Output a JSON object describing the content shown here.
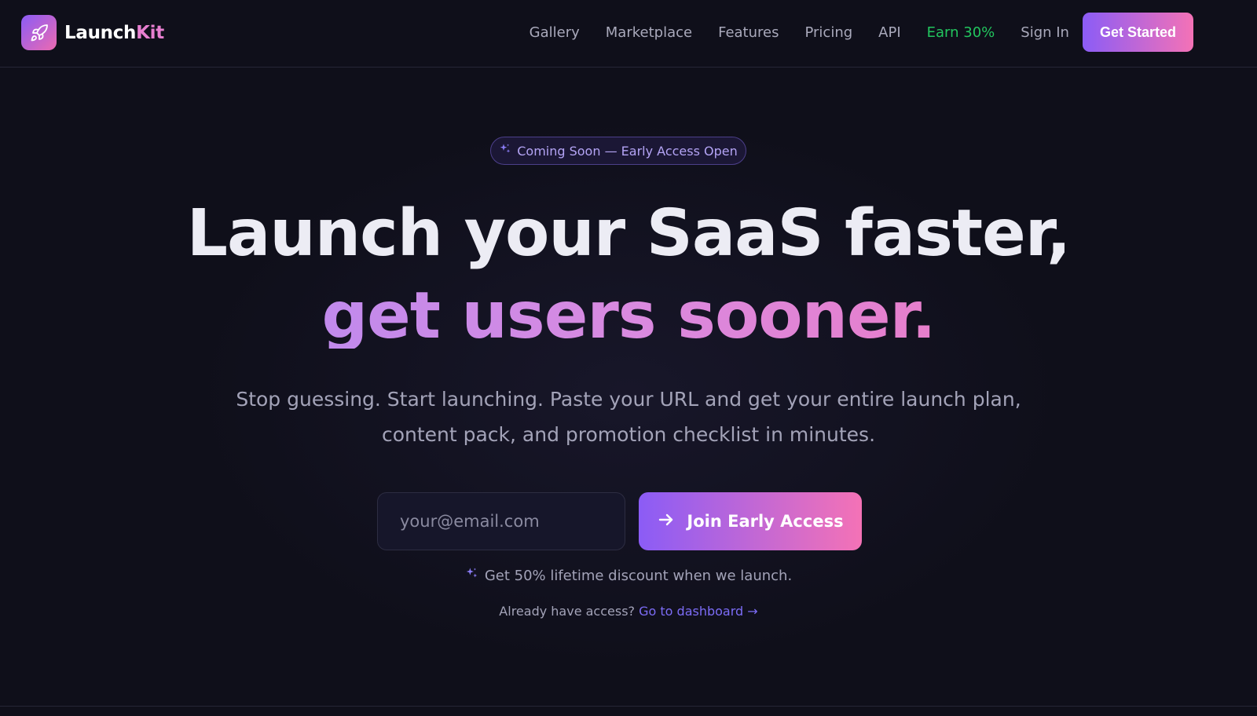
{
  "brand": {
    "name_main": "Launch",
    "name_accent": "Kit",
    "logo_icon": "rocket-icon"
  },
  "nav": {
    "links": [
      "Gallery",
      "Marketplace",
      "Features",
      "Pricing",
      "API"
    ],
    "earn": "Earn 30%",
    "sign_in": "Sign In",
    "cta": "Get Started"
  },
  "hero": {
    "badge": "Coming Soon — Early Access Open",
    "headline_line1": "Launch your SaaS faster,",
    "headline_line2": "get users sooner.",
    "subtitle": "Stop guessing. Start launching. Paste your URL and get your entire launch plan, content pack, and promotion checklist in minutes.",
    "email_placeholder": "your@email.com",
    "join_button": "Join Early Access",
    "discount_note": "Get 50% lifetime discount when we launch.",
    "already_text": "Already have access?",
    "dashboard_link": "Go to dashboard →"
  },
  "colors": {
    "background": "#0f0f1a",
    "accent_purple": "#8b5cf6",
    "accent_pink": "#f472b6",
    "earn_green": "#22c55e",
    "link_blue": "#7c6cf6"
  }
}
